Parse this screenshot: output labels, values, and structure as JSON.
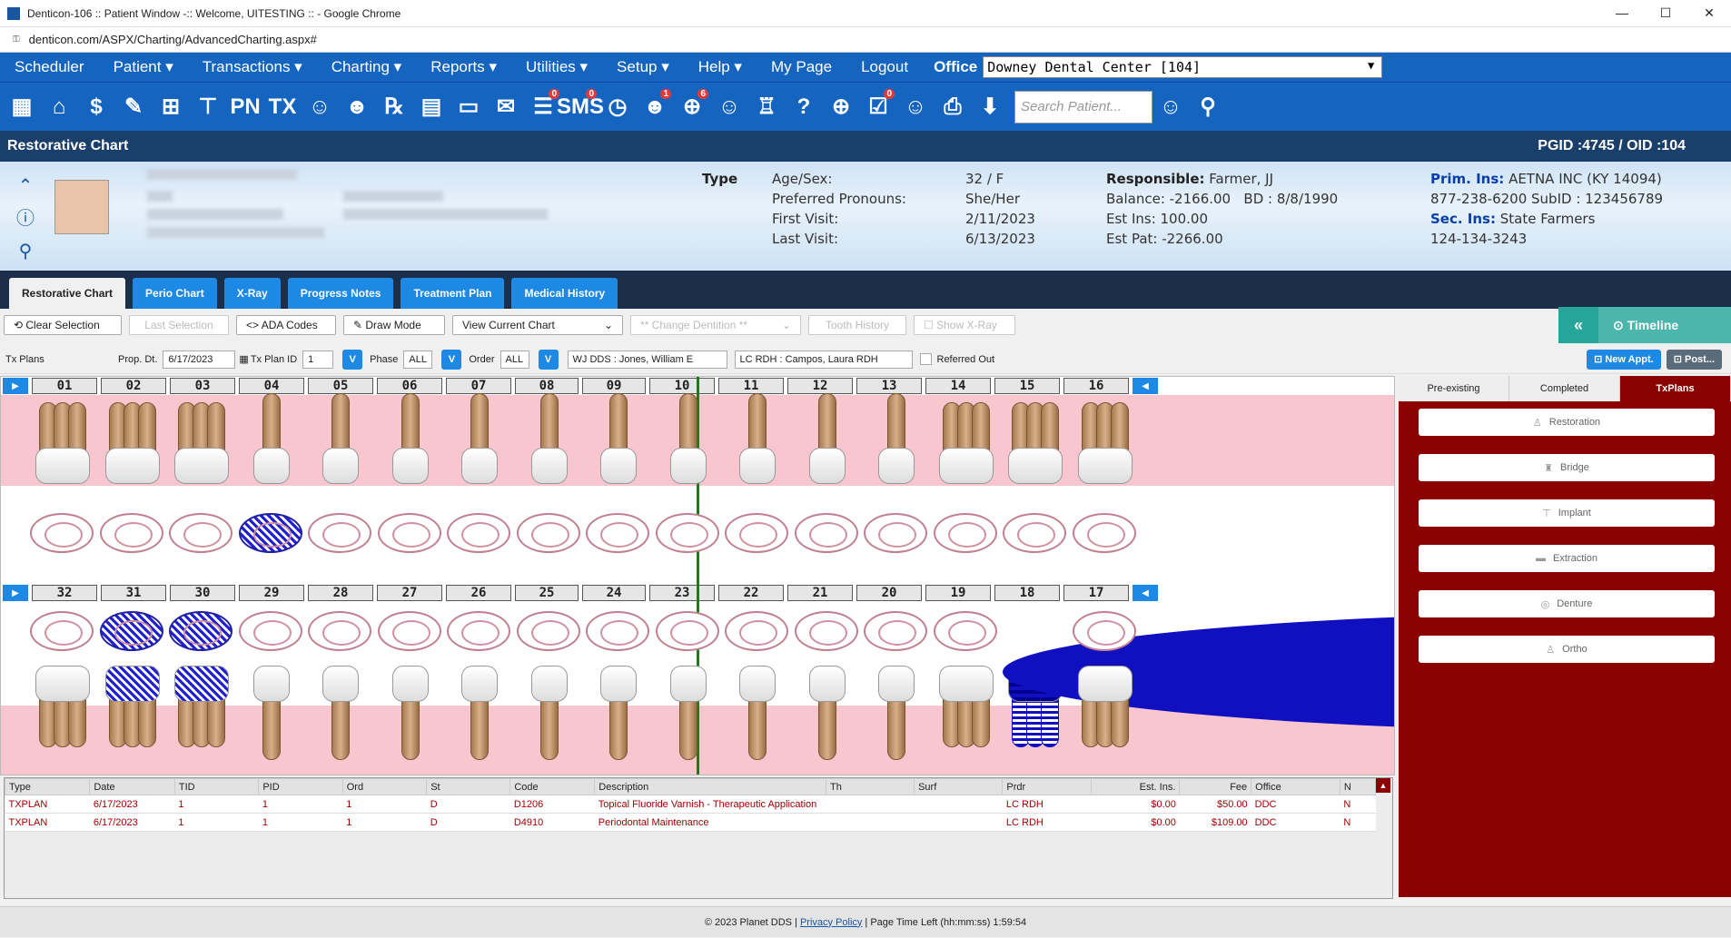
{
  "window": {
    "title": "Denticon-106 :: Patient Window -:: Welcome, UITESTING :: - Google Chrome",
    "url": "denticon.com/ASPX/Charting/AdvancedCharting.aspx#"
  },
  "menu": {
    "items": [
      "Scheduler",
      "Patient ▾",
      "Transactions ▾",
      "Charting ▾",
      "Reports ▾",
      "Utilities ▾",
      "Setup ▾",
      "Help ▾",
      "My Page",
      "Logout"
    ],
    "office_label": "Office",
    "office_value": "Downey Dental Center [104]"
  },
  "iconbar": {
    "icons": [
      "calendar-icon",
      "home-icon",
      "dollar-icon",
      "edit-icon",
      "tooth-chart-icon",
      "implant-icon",
      "pn-icon",
      "tx-icon",
      "add-person-icon",
      "add-group-icon",
      "rx-icon",
      "note-icon",
      "print-form-icon",
      "email-icon",
      "message-icon",
      "sms-icon",
      "clock-icon",
      "alert-person-icon",
      "globe-person-icon",
      "family-icon",
      "tooth-icon",
      "question-tooth-icon",
      "globe-icon",
      "task-icon",
      "people-icon",
      "printer-icon",
      "download-icon"
    ],
    "glyphs": [
      "▦",
      "⌂",
      "$",
      "✎",
      "⊞",
      "⊤",
      "PN",
      "TX",
      "☺",
      "☻",
      "℞",
      "▤",
      "▭",
      "✉",
      "☰",
      "SMS",
      "◷",
      "☻",
      "⊕",
      "☺",
      "♖",
      "?",
      "⊕",
      "☑",
      "☺",
      "⎙",
      "⬇"
    ],
    "badges": {
      "message-icon": "0",
      "sms-icon": "0",
      "alert-person-icon": "1",
      "globe-person-icon": "6",
      "task-icon": "0"
    },
    "search_placeholder": "Search Patient..."
  },
  "chart_header": {
    "title": "Restorative Chart",
    "ids": "PGID :4745  /  OID :104"
  },
  "patient": {
    "type_label": "Type",
    "age_label": "Age/Sex:",
    "age_value": "32 / F",
    "pronoun_label": "Preferred Pronouns:",
    "pronoun_value": "She/Her",
    "first_visit_label": "First Visit:",
    "first_visit_value": "2/11/2023",
    "last_visit_label": "Last Visit:",
    "last_visit_value": "6/13/2023",
    "responsible_label": "Responsible:",
    "responsible_value": "Farmer, JJ",
    "balance": "Balance: -2166.00",
    "bd": "BD : 8/8/1990",
    "est_ins": "Est Ins:  100.00",
    "est_pat": "Est Pat: -2266.00",
    "prim_ins_label": "Prim. Ins:",
    "prim_ins_value": "AETNA INC (KY 14094)",
    "prim_phone": "877-238-6200 SubID : 123456789",
    "sec_ins_label": "Sec. Ins:",
    "sec_ins_value": "State Farmers",
    "sec_phone": "124-134-3243"
  },
  "tabs": [
    "Restorative Chart",
    "Perio Chart",
    "X-Ray",
    "Progress Notes",
    "Treatment Plan",
    "Medical History"
  ],
  "toolbar": {
    "clear": "⟲ Clear Selection",
    "last": "Last Selection",
    "ada": "<> ADA Codes",
    "draw": "✎ Draw Mode",
    "view": "View Current Chart",
    "change": "** Change Dentition **",
    "history": "Tooth History",
    "xray": "☐ Show X-Ray",
    "timeline": "⊙ Timeline"
  },
  "txbar": {
    "label": "Tx Plans",
    "prop_dt_label": "Prop. Dt.",
    "prop_dt": "6/17/2023",
    "plan_id_label": "Tx Plan ID",
    "plan_id": "1",
    "phase_label": "Phase",
    "phase": "ALL",
    "order_label": "Order",
    "order": "ALL",
    "provider1": "WJ DDS : Jones, William E",
    "provider2": "LC RDH : Campos, Laura RDH",
    "referred": "Referred Out",
    "new_appt": "⊡ New Appt.",
    "post": "⊡ Post..."
  },
  "upper_teeth": [
    "01",
    "02",
    "03",
    "04",
    "05",
    "06",
    "07",
    "08",
    "09",
    "10",
    "11",
    "12",
    "13",
    "14",
    "15",
    "16"
  ],
  "lower_teeth": [
    "32",
    "31",
    "30",
    "29",
    "28",
    "27",
    "26",
    "25",
    "24",
    "23",
    "22",
    "21",
    "20",
    "19",
    "18",
    "17"
  ],
  "right_panel": {
    "tabs": [
      "Pre-existing",
      "Completed",
      "TxPlans"
    ],
    "buttons": [
      {
        "icon": "♙",
        "label": "Restoration"
      },
      {
        "icon": "♜",
        "label": "Bridge"
      },
      {
        "icon": "⊤",
        "label": "Implant"
      },
      {
        "icon": "▬",
        "label": "Extraction"
      },
      {
        "icon": "◎",
        "label": "Denture"
      },
      {
        "icon": "♙",
        "label": "Ortho"
      }
    ]
  },
  "grid": {
    "headers": [
      "Type",
      "Date",
      "TID",
      "PID",
      "Ord",
      "St",
      "Code",
      "Description",
      "Th",
      "Surf",
      "Prdr",
      "Est. Ins.",
      "Fee",
      "Office",
      "N"
    ],
    "rows": [
      [
        "TXPLAN",
        "6/17/2023",
        "1",
        "1",
        "1",
        "D",
        "D1206",
        "Topical Fluoride Varnish - Therapeutic Application",
        "",
        "",
        "LC RDH",
        "$0.00",
        "$50.00",
        "DDC",
        "N"
      ],
      [
        "TXPLAN",
        "6/17/2023",
        "1",
        "1",
        "1",
        "D",
        "D4910",
        "Periodontal Maintenance",
        "",
        "",
        "LC RDH",
        "$0.00",
        "$109.00",
        "DDC",
        "N"
      ]
    ]
  },
  "footer": {
    "copyright": "© 2023 Planet DDS |",
    "privacy": "Privacy Policy",
    "time": "| Page Time Left (hh:mm:ss) 1:59:54"
  }
}
